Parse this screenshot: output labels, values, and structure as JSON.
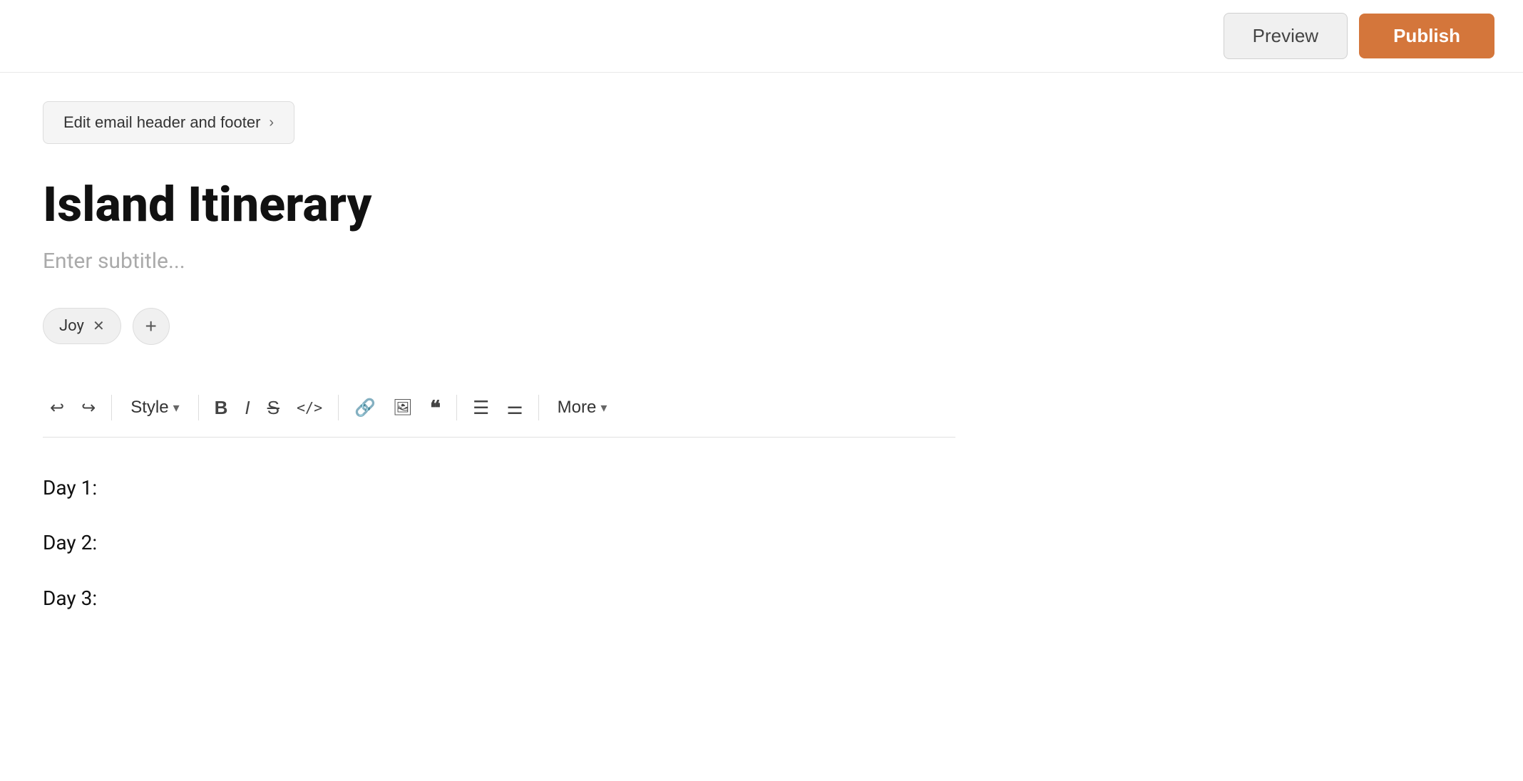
{
  "header": {
    "preview_label": "Preview",
    "publish_label": "Publish"
  },
  "toolbar_section": {
    "edit_email_label": "Edit email header and footer",
    "chevron": "›"
  },
  "editor": {
    "title": "Island Itinerary",
    "subtitle_placeholder": "Enter subtitle...",
    "tags": [
      {
        "label": "Joy",
        "removable": true
      }
    ],
    "add_tag_label": "+",
    "content_lines": [
      "Day 1:",
      "Day 2:",
      "Day 3:"
    ]
  },
  "toolbar": {
    "undo_label": "↩",
    "redo_label": "↪",
    "style_label": "Style",
    "bold_label": "B",
    "italic_label": "I",
    "strikethrough_label": "S",
    "code_label": "</>",
    "link_label": "🔗",
    "image_label": "⬜",
    "quote_label": "❝",
    "ul_label": "☰",
    "ol_label": "☷",
    "more_label": "More",
    "dropdown_arrow": "▾"
  },
  "colors": {
    "publish_bg": "#d4763b",
    "preview_bg": "#f0f0f0",
    "tag_bg": "#f0f0f0"
  }
}
